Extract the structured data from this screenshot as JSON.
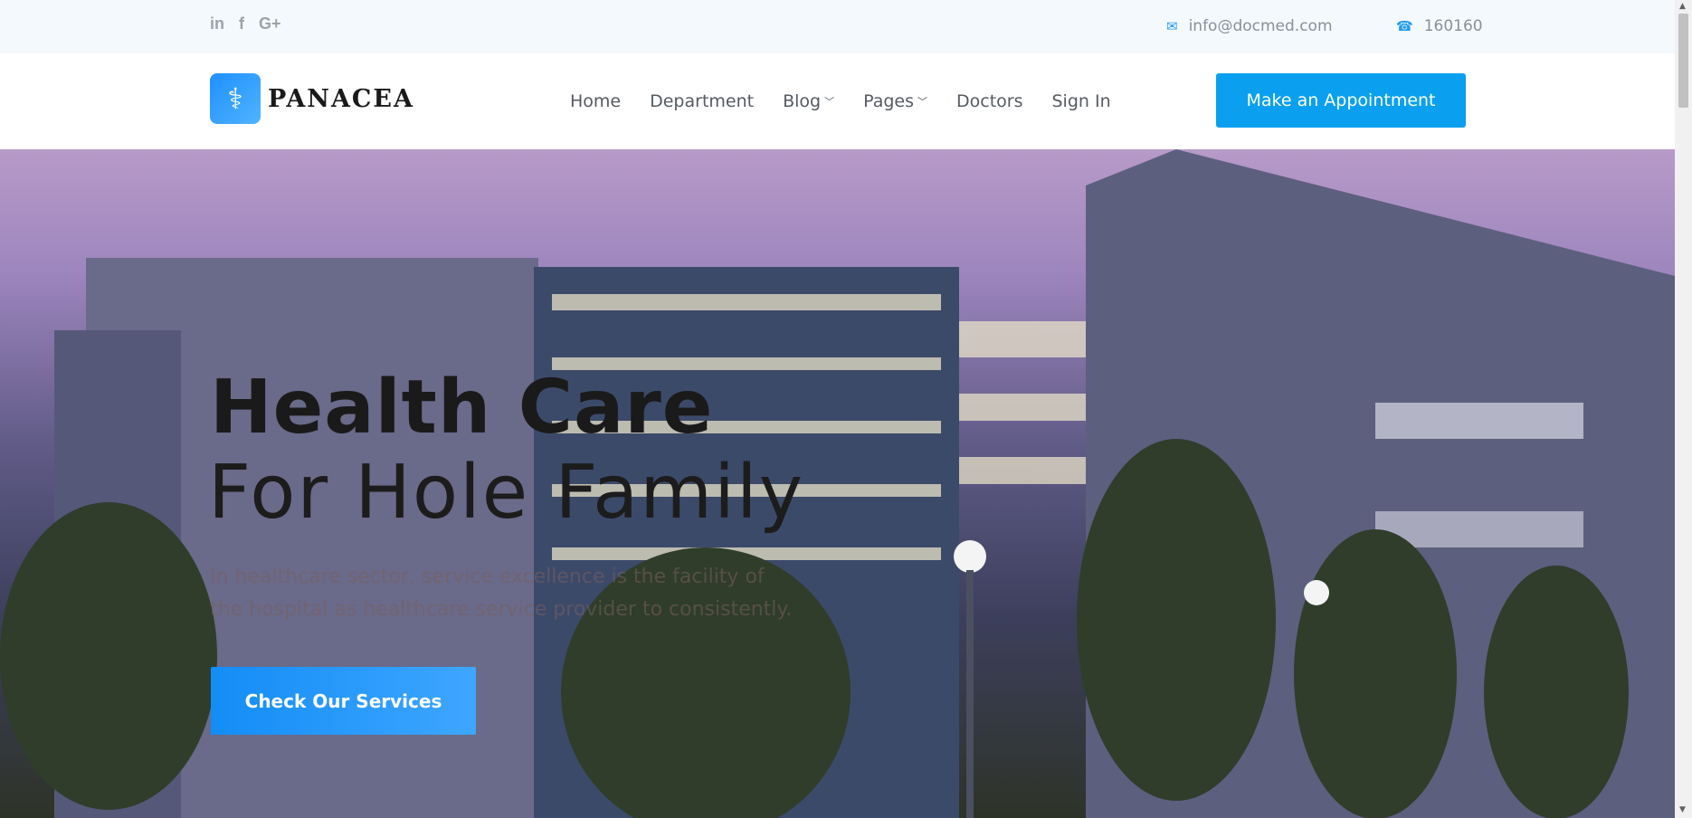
{
  "topbar": {
    "social": [
      {
        "icon": "linkedin-icon",
        "glyph": "in"
      },
      {
        "icon": "facebook-icon",
        "glyph": "f"
      },
      {
        "icon": "google-plus-icon",
        "glyph": "G+"
      }
    ],
    "email": "info@docmed.com",
    "phone": "160160",
    "email_icon": "envelope-icon",
    "phone_icon": "phone-icon"
  },
  "nav": {
    "logo_text": "PANACEA",
    "logo_icon": "caduceus-icon",
    "items": [
      {
        "label": "Home",
        "dropdown": false
      },
      {
        "label": "Department",
        "dropdown": false
      },
      {
        "label": "Blog",
        "dropdown": true
      },
      {
        "label": "Pages",
        "dropdown": true
      },
      {
        "label": "Doctors",
        "dropdown": false
      },
      {
        "label": "Sign In",
        "dropdown": false
      }
    ],
    "cta_label": "Make an Appointment"
  },
  "hero": {
    "title_line1": "Health Care",
    "title_line2": "For Hole Family",
    "text_line1": "In healthcare sector, service excellence is the facility of",
    "text_line2": "the hospital as healthcare service provider to consistently.",
    "button_label": "Check Our Services"
  },
  "colors": {
    "accent": "#0aa0ef",
    "topbar_bg": "#f4f9fd",
    "icon_blue": "#1e9bf0"
  }
}
